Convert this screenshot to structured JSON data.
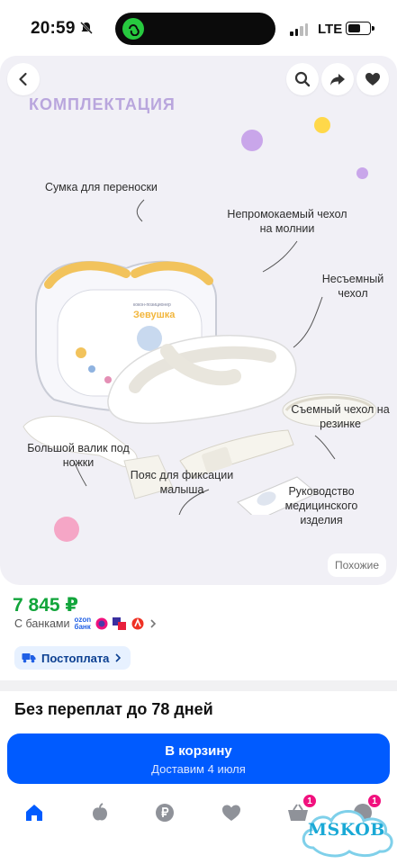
{
  "status_bar": {
    "time": "20:59",
    "network": "LTE",
    "battery_level": 0.6
  },
  "gallery": {
    "heading": "КОМПЛЕКТАЦИЯ",
    "labels": {
      "bag": "Сумка для переноски",
      "waterproof_cover": "Непромокаемый чехол на молнии",
      "fixed_cover": "Несъемный чехол",
      "removable_cover": "Съемный чехол на резинке",
      "roller": "Большой валик под ножки",
      "belt": "Пояс для фиксации малыша",
      "manual": "Руководство медицинского изделия"
    },
    "similar_label": "Похожие",
    "accent_colors": {
      "heading": "#b9a6dd",
      "dot_purple": "#c9a6ea",
      "dot_yellow": "#ffd84a",
      "dot_pink": "#f5a6c6"
    }
  },
  "product": {
    "price": "7 845 ₽",
    "banks_label": "С банками",
    "ozon_label_top": "ozon",
    "ozon_label_bottom": "банк",
    "postpay_label": "Постоплата",
    "no_overpay_text": "Без переплат до 78 дней"
  },
  "cart_button": {
    "title": "В корзину",
    "subtitle": "Доставим 4 июля"
  },
  "nav": {
    "cart_badge": "1",
    "profile_badge": "1"
  },
  "watermark": {
    "text": "MSKOB"
  },
  "colors": {
    "brand_blue": "#005bff",
    "price_green": "#12a53b",
    "badge_pink": "#f1117e"
  }
}
